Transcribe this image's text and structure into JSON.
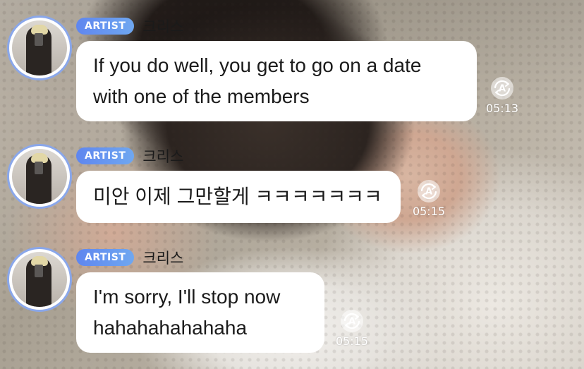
{
  "messages": [
    {
      "badge": "ARTIST",
      "name": "크리스",
      "text": "If you do well, you get to go on a date with one of the members",
      "time": "05:13",
      "icon": "translate-icon"
    },
    {
      "badge": "ARTIST",
      "name": "크리스",
      "text": "미안 이제 그만할게 ㅋㅋㅋㅋㅋㅋㅋ",
      "time": "05:15",
      "icon": "translate-icon"
    },
    {
      "badge": "ARTIST",
      "name": "크리스",
      "text": "I'm sorry, I'll stop now hahahahahahaha",
      "time": "05:15",
      "icon": "translate-icon"
    }
  ],
  "colors": {
    "badge": "#6a93ef",
    "bubble": "#ffffff",
    "avatar_ring": "#8aa7ea",
    "time": "#ffffff"
  }
}
